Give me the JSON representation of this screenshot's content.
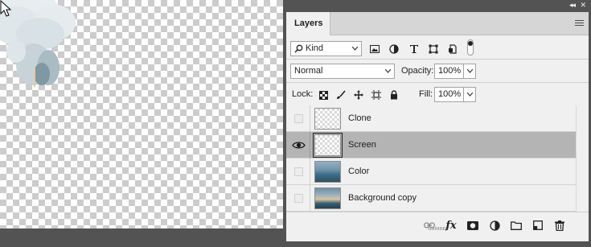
{
  "panel": {
    "collapse_glyph": "◂◂",
    "close_glyph": "✕",
    "tab_label": "Layers",
    "menu_icon": "hamburger-menu-icon"
  },
  "filter": {
    "kind_label": "Kind",
    "kind_icon": "search-icon",
    "filter_icons": [
      "image-filter-icon",
      "adjustment-filter-icon",
      "type-filter-icon",
      "shape-filter-icon",
      "smart-object-filter-icon",
      "filter-toggle-icon"
    ]
  },
  "blend": {
    "mode": "Normal",
    "opacity_label": "Opacity:",
    "opacity_value": "100%"
  },
  "lock": {
    "label": "Lock:",
    "icons": [
      "lock-transparent-pixels-icon",
      "lock-image-pixels-icon",
      "lock-position-icon",
      "lock-artboard-icon",
      "lock-all-icon"
    ],
    "fill_label": "Fill:",
    "fill_value": "100%"
  },
  "layers": [
    {
      "name": "Clone",
      "visible": false,
      "selected": false,
      "thumb": "transparent"
    },
    {
      "name": "Screen",
      "visible": true,
      "selected": true,
      "thumb": "transparent"
    },
    {
      "name": "Color",
      "visible": false,
      "selected": false,
      "thumb": "photo"
    },
    {
      "name": "Background copy",
      "visible": false,
      "selected": false,
      "thumb": "photo2"
    }
  ],
  "footer": {
    "icons": [
      "link-layers-icon",
      "layer-style-fx-icon",
      "add-mask-icon",
      "new-adjustment-layer-icon",
      "new-group-icon",
      "new-layer-icon",
      "delete-layer-icon"
    ],
    "fx_label": "fx"
  },
  "colors": {
    "panel_bg": "#f0f0f0",
    "selected_row": "#b4b4b4",
    "app_bg": "#535353"
  }
}
